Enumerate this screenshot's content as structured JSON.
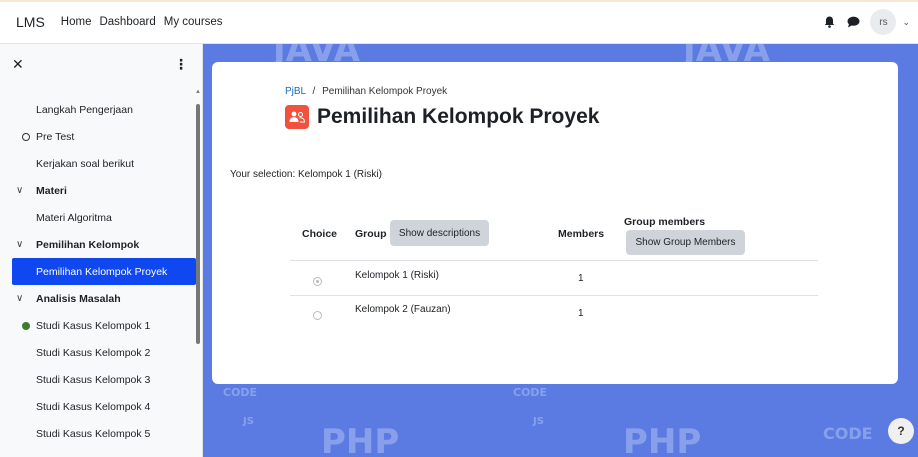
{
  "navbar": {
    "brand": "LMS",
    "links": [
      "Home",
      "Dashboard",
      "My courses"
    ],
    "avatar_initials": "rs",
    "icons": [
      "bell-icon",
      "chat-icon",
      "chevron-down-icon"
    ]
  },
  "drawer": {
    "items": [
      {
        "label": "Langkah Pengerjaan",
        "type": "item"
      },
      {
        "label": "Pre Test",
        "type": "item",
        "mark": "circle-outline"
      },
      {
        "label": "Kerjakan soal berikut",
        "type": "item"
      },
      {
        "label": "Materi",
        "type": "section"
      },
      {
        "label": "Materi Algoritma",
        "type": "item"
      },
      {
        "label": "Pemilihan Kelompok",
        "type": "section"
      },
      {
        "label": "Pemilihan Kelompok Proyek",
        "type": "active"
      },
      {
        "label": "Analisis Masalah",
        "type": "section"
      },
      {
        "label": "Studi Kasus Kelompok 1",
        "type": "item",
        "mark": "circle-filled"
      },
      {
        "label": "Studi Kasus Kelompok 2",
        "type": "item"
      },
      {
        "label": "Studi Kasus Kelompok 3",
        "type": "item"
      },
      {
        "label": "Studi Kasus Kelompok 4",
        "type": "item"
      },
      {
        "label": "Studi Kasus Kelompok 5",
        "type": "item"
      }
    ]
  },
  "main": {
    "breadcrumb_course": "PjBL",
    "breadcrumb_sep": "/",
    "breadcrumb_page": "Pemilihan Kelompok Proyek",
    "title": "Pemilihan Kelompok Proyek",
    "selection_text": "Your selection: Kelompok 1 (Riski)",
    "table": {
      "col_choice": "Choice",
      "col_group": "Group",
      "show_descriptions": "Show descriptions",
      "col_members": "Members",
      "col_group_members": "Group members",
      "show_group_members": "Show Group Members",
      "rows": [
        {
          "group": "Kelompok 1 (Riski)",
          "members": "1",
          "selected": true
        },
        {
          "group": "Kelompok 2 (Fauzan)",
          "members": "1",
          "selected": false
        }
      ]
    }
  },
  "background_words": [
    "JAVA",
    "PHP",
    "CODE",
    "JS"
  ],
  "help_label": "?",
  "colors": {
    "active": "#0f47f0",
    "background": "#5b7be3",
    "activity_icon": "#f0523d",
    "link": "#0f6cbf"
  }
}
